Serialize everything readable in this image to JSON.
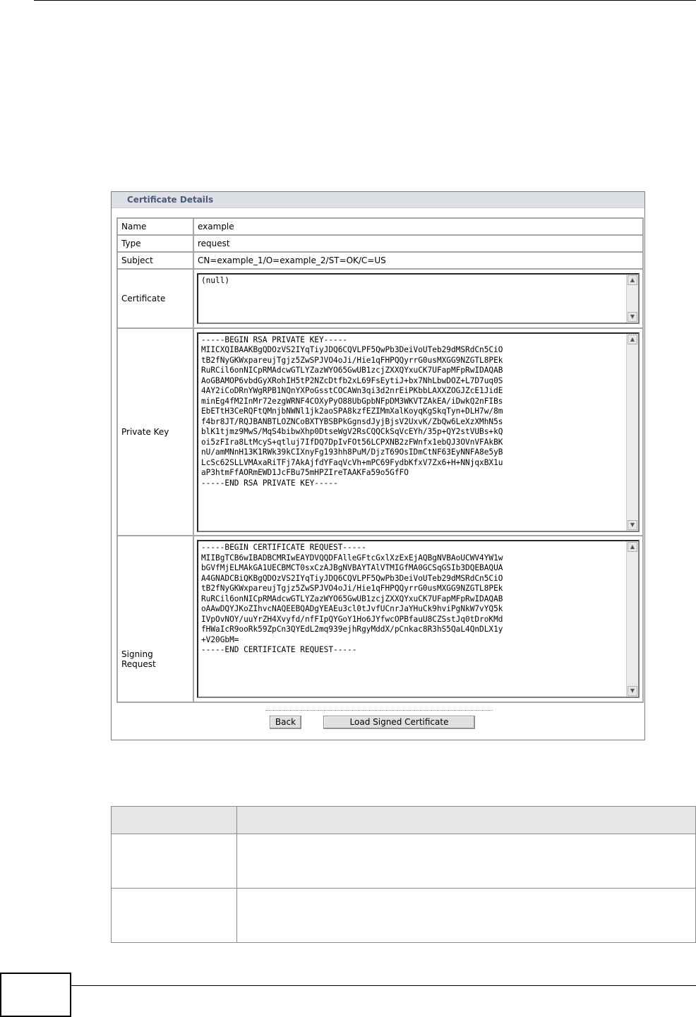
{
  "panel": {
    "title": "Certificate Details",
    "rows": {
      "name": {
        "label": "Name",
        "value": "example"
      },
      "type": {
        "label": "Type",
        "value": "request"
      },
      "subject": {
        "label": "Subject",
        "value": "CN=example_1/O=example_2/ST=OK/C=US"
      },
      "certificate": {
        "label": "Certificate",
        "value": "(null)"
      },
      "private_key": {
        "label": "Private Key",
        "value": "-----BEGIN RSA PRIVATE KEY-----\nMIICXQIBAAKBgQDOzVS2IYqTiyJDQ6CQVLPF5QwPb3DeiVoUTeb29dMSRdCn5CiO\ntB2fNyGKWxpareujTgjz5ZwSPJVO4oJi/Hie1qFHPQQyrrG0usMXGG9NZGTL8PEk\nRuRCil6onNICpRMAdcwGTLYZazWYO65GwUB1zcjZXXQYxuCK7UFapMFpRwIDAQAB\nAoGBAMOP6vbdGyXRohIH5tP2NZcDtfb2xL69FsEytiJ+bx7NhLbwDOZ+L7D7uq0S\n4AY2iCoDRnYWgRPB1NQnYXPoGsstCOCAWn3qi3d2nrEiPKbbLAXXZOGJZcE1JidE\nminEg4fM2InMr72ezgWRNF4COXyPyO88UbGpbNFpDM3WKVTZAkEA/iDwkQ2nFIBs\nEbETtH3CeRQFtQMnjbNWNl1jk2aoSPA8kzfEZIMmXalKoyqKgSkqTyn+DLH7w/8m\nf4br8JT/RQJBANBTLOZNCoBXTYBSBPkGgnsdJyjBjsV2UxvK/ZbQw6LeXzXMhN5s\nblK1tjmz9MwS/MqS4bibwXhp0DtseWgV2RsCQQCkSqVcEYh/35p+QY2stVUBs+kQ\noi5zFIra8LtMcyS+qtluj7IfDQ7DpIvFOt56LCPXNB2zFWnfx1ebQJ3OVnVFAkBK\nnU/amMNnH13K1RWk39kCIXnyFg193hh8PuM/DjzT69OsIDmCtNF63EyNNFA8e5yB\nLcSc62SLLVMAxaRiTFj7AkAjfdYFaqVcVh+mPC69FydbKfxV7Zx6+H+NNjqxBX1u\naP3htmFfAORmEWD1JcFBu75mHPZIreTAAKFa59o5GfFO\n-----END RSA PRIVATE KEY-----"
      },
      "signing_request": {
        "label": "Signing Request",
        "value": "-----BEGIN CERTIFICATE REQUEST-----\nMIIBgTCB6wIBADBCMRIwEAYDVQQDFAllеGFtcGxlXzExEjAQBgNVBAoUCWV4YW1w\nbGVfMjELMAkGA1UECBMCT0sxCzAJBgNVBAYTAlVTMIGfMA0GCSqGSIb3DQEBAQUA\nA4GNADCBiQKBgQDOzVS2IYqTiyJDQ6CQVLPF5QwPb3DeiVoUTeb29dMSRdCn5CiO\ntB2fNyGKWxpareujTgjz5ZwSPJVO4oJi/Hie1qFHPQQyrrG0usMXGG9NZGTL8PEk\nRuRCil6onNICpRMAdcwGTLYZazWYO65GwUB1zcjZXXQYxuCK7UFapMFpRwIDAQAB\noAAwDQYJKoZIhvcNAQEEBQADgYEAEu3cl0tJvfUCnrJaYHuCk9hviPgNkW7vYQ5k\nIVpOvNOY/uuYrZH4Xvyfd/nfFIpQYGoY1Ho6JYfwcOPBfauU8CZSstJq0tDroKMd\nfHWaIcR9ooRk59ZpCn3QYEdL2mq939ejhRgyMddX/pCnkac8R3hS5QaL4QnDLX1y\n+V20GbM=\n-----END CERTIFICATE REQUEST-----"
      }
    },
    "buttons": {
      "back": "Back",
      "load": "Load Signed Certificate"
    }
  },
  "icons": {
    "scroll_up": "scroll-up-arrow-icon",
    "scroll_down": "scroll-down-arrow-icon"
  }
}
